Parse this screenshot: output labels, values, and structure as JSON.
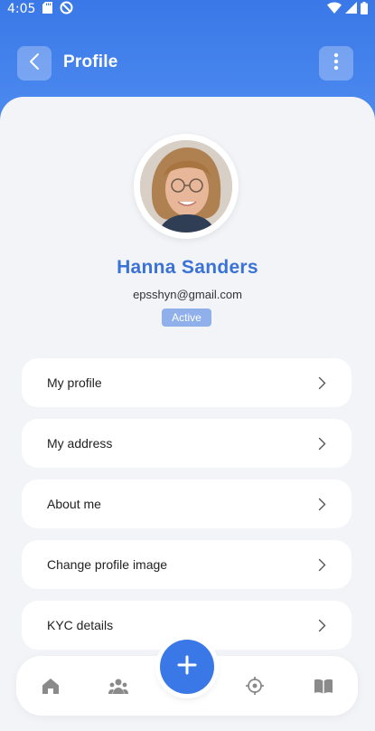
{
  "status_bar": {
    "time": "4:05",
    "left_icons": [
      "sd-card-icon",
      "data-saver-icon"
    ],
    "right_icons": [
      "wifi-icon",
      "signal-icon",
      "battery-icon"
    ]
  },
  "app_bar": {
    "title": "Profile",
    "back_icon": "chevron-left-icon",
    "more_icon": "more-vertical-icon"
  },
  "profile": {
    "name": "Hanna Sanders",
    "email": "epsshyn@gmail.com",
    "status": "Active"
  },
  "menu": {
    "items": [
      {
        "label": "My profile"
      },
      {
        "label": "My address"
      },
      {
        "label": "About me"
      },
      {
        "label": "Change profile image"
      },
      {
        "label": "KYC details"
      }
    ]
  },
  "bottom_nav": {
    "items": [
      "home-icon",
      "group-icon",
      "add-icon",
      "target-icon",
      "book-icon"
    ]
  },
  "colors": {
    "accent": "#3a78e8",
    "name_text": "#3a72d6",
    "badge_bg": "#8fb0ea",
    "sheet_bg": "#f2f4f8",
    "nav_icon": "#8a8a8a"
  }
}
